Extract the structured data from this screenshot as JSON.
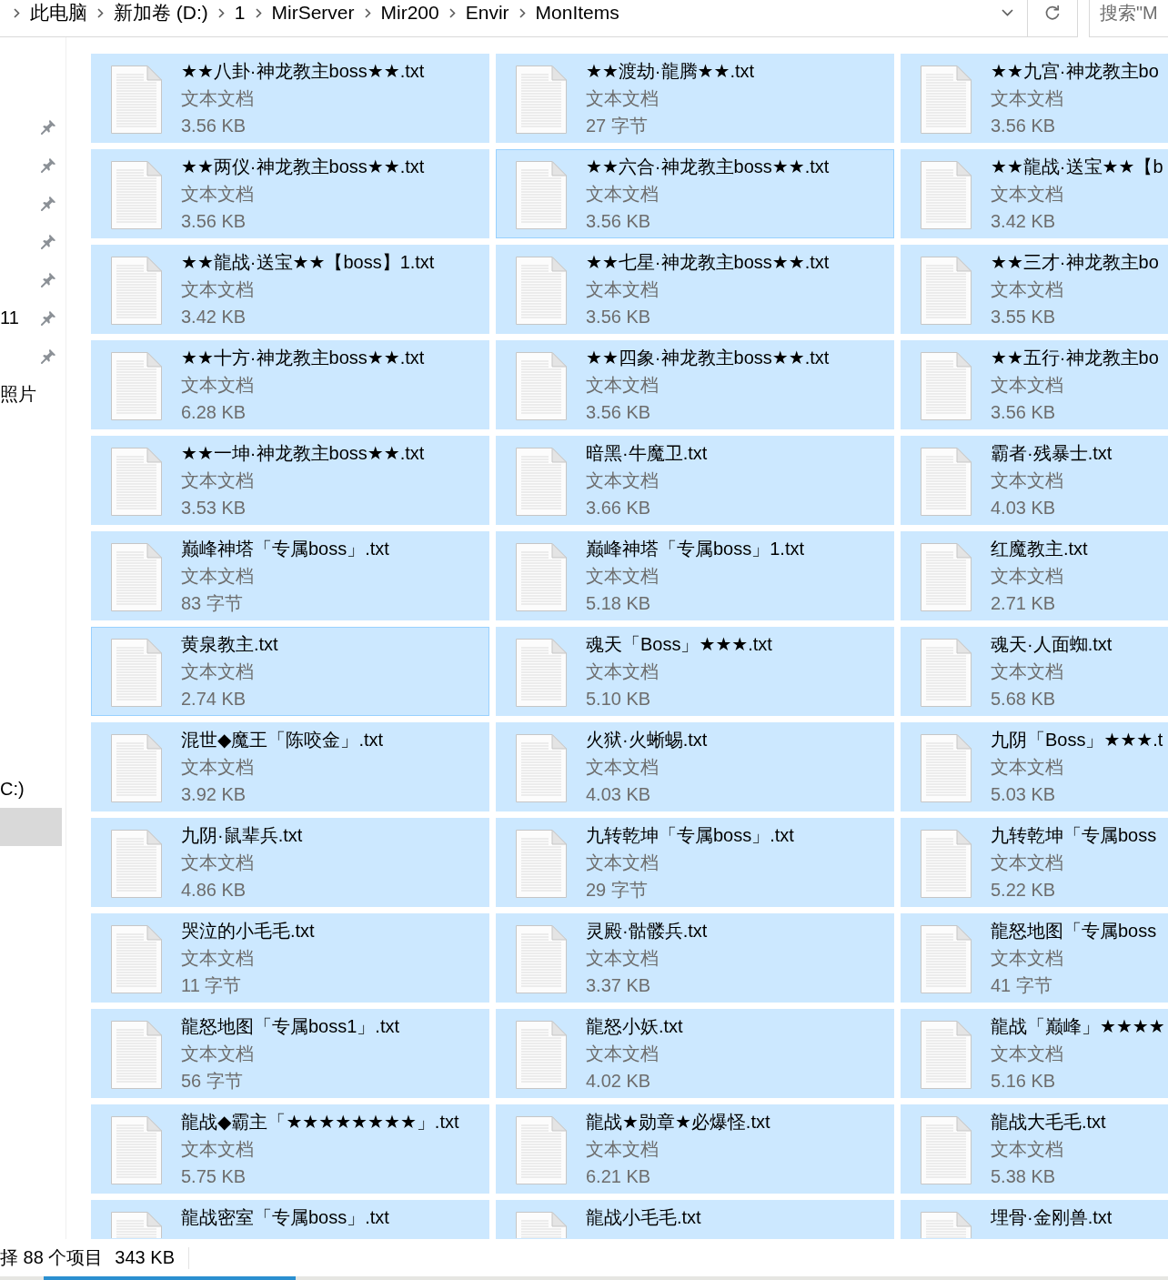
{
  "address_bar": {
    "path": [
      "此电脑",
      "新加卷 (D:)",
      "1",
      "MirServer",
      "Mir200",
      "Envir",
      "MonItems"
    ]
  },
  "search": {
    "placeholder": "搜索\"M"
  },
  "nav_pane": {
    "groups": [
      {
        "items": [
          {
            "pinned": true,
            "selected": false
          },
          {
            "pinned": true,
            "selected": false
          },
          {
            "pinned": true,
            "selected": false
          },
          {
            "pinned": true,
            "selected": false
          },
          {
            "pinned": true,
            "selected": false
          },
          {
            "label": "11",
            "pinned": true,
            "selected": false
          },
          {
            "pinned": true,
            "selected": false
          },
          {
            "label": "照片",
            "pinned": false,
            "selected": false
          }
        ]
      },
      {
        "items": [
          {
            "label": "C:)",
            "pinned": false,
            "selected": false
          },
          {
            "pinned": false,
            "selected": true
          }
        ]
      }
    ]
  },
  "files": [
    {
      "name": "★★八卦·神龙教主boss★★.txt",
      "type": "文本文档",
      "size": "3.56 KB",
      "selected": true,
      "focused": false
    },
    {
      "name": "★★渡劫·龍腾★★.txt",
      "type": "文本文档",
      "size": "27 字节",
      "selected": true,
      "focused": false
    },
    {
      "name": "★★九宫·神龙教主bo",
      "type": "文本文档",
      "size": "3.56 KB",
      "selected": true,
      "focused": false
    },
    {
      "name": "★★两仪·神龙教主boss★★.txt",
      "type": "文本文档",
      "size": "3.56 KB",
      "selected": true,
      "focused": false
    },
    {
      "name": "★★六合·神龙教主boss★★.txt",
      "type": "文本文档",
      "size": "3.56 KB",
      "selected": true,
      "focused": true
    },
    {
      "name": "★★龍战·送宝★★【b",
      "type": "文本文档",
      "size": "3.42 KB",
      "selected": true,
      "focused": false
    },
    {
      "name": "★★龍战·送宝★★【boss】1.txt",
      "type": "文本文档",
      "size": "3.42 KB",
      "selected": true,
      "focused": false
    },
    {
      "name": "★★七星·神龙教主boss★★.txt",
      "type": "文本文档",
      "size": "3.56 KB",
      "selected": true,
      "focused": false
    },
    {
      "name": "★★三才·神龙教主bo",
      "type": "文本文档",
      "size": "3.55 KB",
      "selected": true,
      "focused": false
    },
    {
      "name": "★★十方·神龙教主boss★★.txt",
      "type": "文本文档",
      "size": "6.28 KB",
      "selected": true,
      "focused": false
    },
    {
      "name": "★★四象·神龙教主boss★★.txt",
      "type": "文本文档",
      "size": "3.56 KB",
      "selected": true,
      "focused": false
    },
    {
      "name": "★★五行·神龙教主bo",
      "type": "文本文档",
      "size": "3.56 KB",
      "selected": true,
      "focused": false
    },
    {
      "name": "★★一坤·神龙教主boss★★.txt",
      "type": "文本文档",
      "size": "3.53 KB",
      "selected": true,
      "focused": false
    },
    {
      "name": "暗黑·牛魔卫.txt",
      "type": "文本文档",
      "size": "3.66 KB",
      "selected": true,
      "focused": false
    },
    {
      "name": "霸者·残暴士.txt",
      "type": "文本文档",
      "size": "4.03 KB",
      "selected": true,
      "focused": false
    },
    {
      "name": "巅峰神塔「专属boss」.txt",
      "type": "文本文档",
      "size": "83 字节",
      "selected": true,
      "focused": false
    },
    {
      "name": "巅峰神塔「专属boss」1.txt",
      "type": "文本文档",
      "size": "5.18 KB",
      "selected": true,
      "focused": false
    },
    {
      "name": "红魔教主.txt",
      "type": "文本文档",
      "size": "2.71 KB",
      "selected": true,
      "focused": false
    },
    {
      "name": "黄泉教主.txt",
      "type": "文本文档",
      "size": "2.74 KB",
      "selected": true,
      "focused": true
    },
    {
      "name": "魂天「Boss」★★★.txt",
      "type": "文本文档",
      "size": "5.10 KB",
      "selected": true,
      "focused": false
    },
    {
      "name": "魂天·人面蜘.txt",
      "type": "文本文档",
      "size": "5.68 KB",
      "selected": true,
      "focused": false
    },
    {
      "name": "混世◆魔王「陈咬金」.txt",
      "type": "文本文档",
      "size": "3.92 KB",
      "selected": true,
      "focused": false
    },
    {
      "name": "火狱·火蜥蜴.txt",
      "type": "文本文档",
      "size": "4.03 KB",
      "selected": true,
      "focused": false
    },
    {
      "name": "九阴「Boss」★★★.t",
      "type": "文本文档",
      "size": "5.03 KB",
      "selected": true,
      "focused": false
    },
    {
      "name": "九阴·鼠辈兵.txt",
      "type": "文本文档",
      "size": "4.86 KB",
      "selected": true,
      "focused": false
    },
    {
      "name": "九转乾坤「专属boss」.txt",
      "type": "文本文档",
      "size": "29 字节",
      "selected": true,
      "focused": false
    },
    {
      "name": "九转乾坤「专属boss",
      "type": "文本文档",
      "size": "5.22 KB",
      "selected": true,
      "focused": false
    },
    {
      "name": "哭泣的小毛毛.txt",
      "type": "文本文档",
      "size": "11 字节",
      "selected": true,
      "focused": false
    },
    {
      "name": "灵殿·骷髅兵.txt",
      "type": "文本文档",
      "size": "3.37 KB",
      "selected": true,
      "focused": false
    },
    {
      "name": "龍怒地图「专属boss",
      "type": "文本文档",
      "size": "41 字节",
      "selected": true,
      "focused": false
    },
    {
      "name": "龍怒地图「专属boss1」.txt",
      "type": "文本文档",
      "size": "56 字节",
      "selected": true,
      "focused": false
    },
    {
      "name": "龍怒小妖.txt",
      "type": "文本文档",
      "size": "4.02 KB",
      "selected": true,
      "focused": false
    },
    {
      "name": "龍战「巅峰」★★★★",
      "type": "文本文档",
      "size": "5.16 KB",
      "selected": true,
      "focused": false
    },
    {
      "name": "龍战◆霸主「★★★★★★★★」.txt",
      "type": "文本文档",
      "size": "5.75 KB",
      "selected": true,
      "focused": false
    },
    {
      "name": "龍战★勋章★必爆怪.txt",
      "type": "文本文档",
      "size": "6.21 KB",
      "selected": true,
      "focused": false
    },
    {
      "name": "龍战大毛毛.txt",
      "type": "文本文档",
      "size": "5.38 KB",
      "selected": true,
      "focused": false
    },
    {
      "name": "龍战密室「专属boss」.txt",
      "selected": true,
      "focused": false
    },
    {
      "name": "龍战小毛毛.txt",
      "selected": true,
      "focused": false
    },
    {
      "name": "埋骨·金刚兽.txt",
      "selected": true,
      "focused": false
    }
  ],
  "status_bar": {
    "selection": "择 88 个项目",
    "size": "343 KB"
  }
}
